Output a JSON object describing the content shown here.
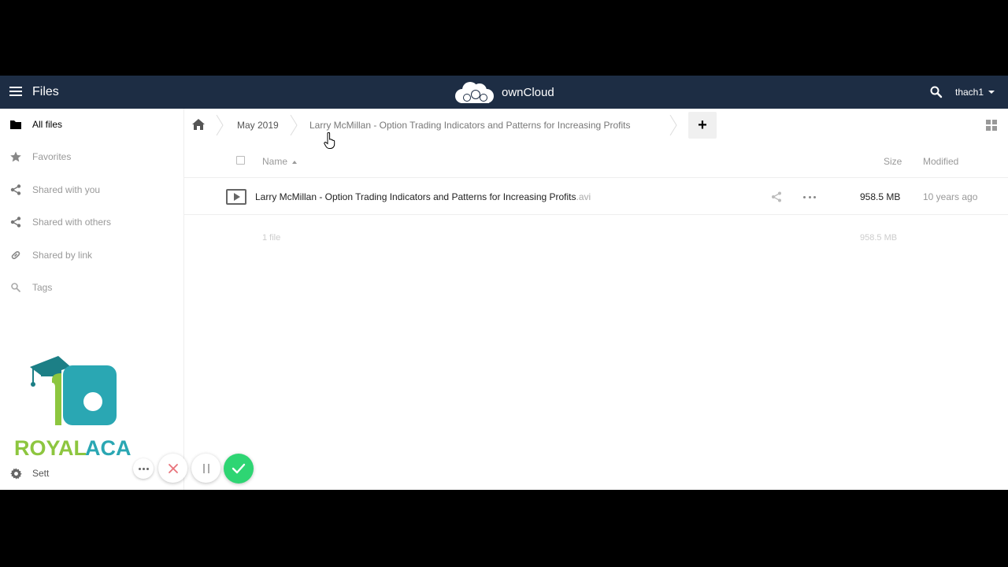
{
  "header": {
    "title": "Files",
    "brand": "ownCloud",
    "user": "thach1"
  },
  "sidebar": {
    "items": [
      {
        "label": "All files",
        "icon": "folder-icon",
        "active": true
      },
      {
        "label": "Favorites",
        "icon": "star-icon"
      },
      {
        "label": "Shared with you",
        "icon": "share-icon"
      },
      {
        "label": "Shared with others",
        "icon": "share-icon"
      },
      {
        "label": "Shared by link",
        "icon": "link-icon"
      },
      {
        "label": "Tags",
        "icon": "tag-search-icon"
      }
    ],
    "logo_text": "ROYALACA",
    "settings_label": "Sett"
  },
  "breadcrumb": {
    "items": [
      "May 2019",
      "Larry McMillan - Option Trading Indicators and Patterns for Increasing Profits"
    ]
  },
  "table": {
    "columns": {
      "name": "Name",
      "size": "Size",
      "modified": "Modified"
    },
    "rows": [
      {
        "name": "Larry McMillan - Option Trading Indicators and Patterns for Increasing Profits",
        "ext": ".avi",
        "size": "958.5 MB",
        "modified": "10 years ago"
      }
    ],
    "summary": {
      "count": "1 file",
      "size": "958.5 MB"
    }
  },
  "colors": {
    "header_bg": "#1d2d44",
    "confirm_green": "#2ed573",
    "cancel_red": "#e8727a"
  }
}
